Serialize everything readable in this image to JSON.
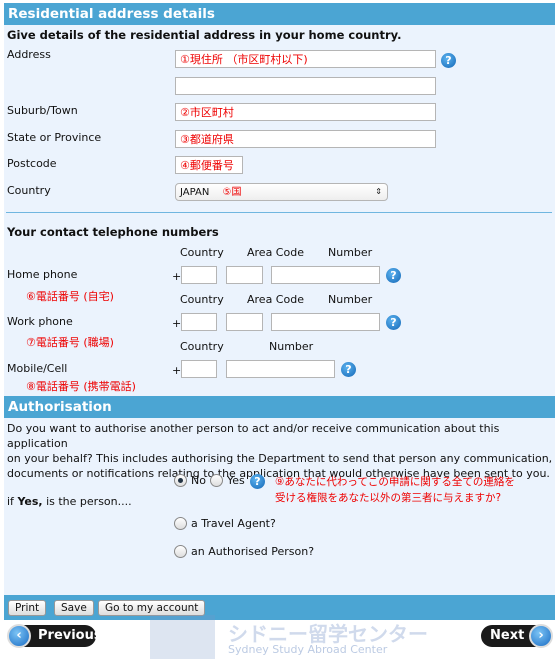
{
  "residential": {
    "title": "Residential address details",
    "subtitle": "Give details of the residential address in your home country.",
    "address_label": "Address",
    "address_value": "①現住所 （市区町村以下)",
    "address2_value": "",
    "suburb_label": "Suburb/Town",
    "suburb_value": "②市区町村",
    "state_label": "State or Province",
    "state_value": "③都道府県",
    "postcode_label": "Postcode",
    "postcode_value": "④郵便番号",
    "country_label": "Country",
    "country_value": "JAPAN",
    "country_note": "⑤国"
  },
  "phones": {
    "title": "Your contact telephone numbers",
    "col_country": "Country",
    "col_area": "Area Code",
    "col_number": "Number",
    "plus": "+",
    "home_label": "Home phone",
    "home_note": "⑥電話番号 (自宅)",
    "work_label": "Work phone",
    "work_note": "⑦電話番号 (職場)",
    "mobile_label": "Mobile/Cell",
    "mobile_note": "⑧電話番号 (携帯電話)"
  },
  "auth": {
    "title": "Authorisation",
    "question_line1": "Do you want to authorise another person to act and/or receive communication about this application",
    "question_line2": "on your behalf? This includes authorising the Department to send that person any communication,",
    "question_line3": "documents or notifications relating to the application that would otherwise have been sent to you.",
    "no_label": "No",
    "yes_label": "Yes",
    "selected": "No",
    "note_line1": "⑨あなたに代わってこの申請に関する全ての連絡を",
    "note_line2": "受ける権限をあなた以外の第三者に与えますか?",
    "if_prefix": "if ",
    "if_bold": "Yes,",
    "if_suffix": " is the person....",
    "travel_agent": "a Travel Agent?",
    "authorised_person": "an Authorised Person?"
  },
  "toolbar": {
    "print": "Print",
    "save": "Save",
    "account": "Go to my account"
  },
  "nav": {
    "previous": "Previous",
    "next": "Next"
  },
  "watermark": {
    "jp": "シドニー留学センター",
    "en": "Sydney Study Abroad Center"
  },
  "help_glyph": "?",
  "colors": {
    "header": "#4ba5d3",
    "panel": "#ebf3fd",
    "annotation": "#ee0000"
  }
}
